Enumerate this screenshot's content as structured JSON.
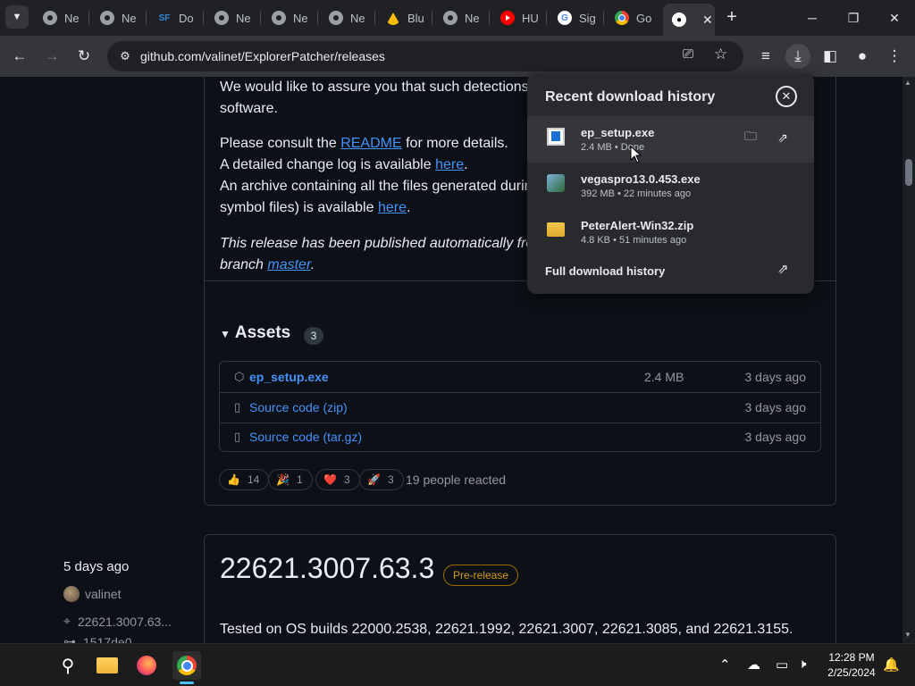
{
  "tabs": [
    {
      "label": "Ne",
      "icon": "chrome-icon"
    },
    {
      "label": "Ne",
      "icon": "chrome-icon"
    },
    {
      "label": "Do",
      "icon": "sf-icon",
      "icon_text": "SF"
    },
    {
      "label": "Ne",
      "icon": "chrome-icon"
    },
    {
      "label": "Ne",
      "icon": "chrome-icon"
    },
    {
      "label": "Ne",
      "icon": "chrome-icon"
    },
    {
      "label": "Blu",
      "icon": "drive-icon"
    },
    {
      "label": "Ne",
      "icon": "chrome-icon"
    },
    {
      "label": "HU",
      "icon": "youtube-icon"
    },
    {
      "label": "Sig",
      "icon": "google-icon",
      "icon_text": "G"
    },
    {
      "label": "Go",
      "icon": "chrome-icon"
    },
    {
      "label": "",
      "icon": "github-icon",
      "active": true
    }
  ],
  "toolbar": {
    "url": "github.com/valinet/ExplorerPatcher/releases"
  },
  "page": {
    "para1_line1": "We would like to assure you that such detections",
    "para1_line2": "software.",
    "consult_prefix": "Please consult the ",
    "readme_link": "README",
    "consult_suffix": " for more details.",
    "changelog_prefix": "A detailed change log is available ",
    "changelog_link": "here",
    "changelog_suffix": ".",
    "archive_line1": "An archive containing all the files generated durin",
    "archive_prefix2": "symbol files) is available ",
    "archive_link": "here",
    "archive_suffix": ".",
    "published_line1": "This release has been published automatically fron",
    "published_prefix2": "branch ",
    "published_link": "master",
    "published_suffix": "."
  },
  "assets": {
    "title": "Assets",
    "count": "3",
    "rows": [
      {
        "name": "ep_setup.exe",
        "bold": true,
        "size": "2.4 MB",
        "date": "3 days ago",
        "icon": "package-icon"
      },
      {
        "name": "Source code (zip)",
        "bold": false,
        "size": "",
        "date": "3 days ago",
        "icon": "file-zip-icon"
      },
      {
        "name": "Source code (tar.gz)",
        "bold": false,
        "size": "",
        "date": "3 days ago",
        "icon": "file-zip-icon"
      }
    ]
  },
  "reactions": [
    {
      "emoji": "👍",
      "count": "14"
    },
    {
      "emoji": "🎉",
      "count": "1"
    },
    {
      "emoji": "❤️",
      "count": "3"
    },
    {
      "emoji": "🚀",
      "count": "3"
    }
  ],
  "reacted_text": "19 people reacted",
  "next_release": {
    "side_date": "5 days ago",
    "author": "valinet",
    "tag": "22621.3007.63...",
    "commit": "1517de0",
    "title": "22621.3007.63.3",
    "badge": "Pre-release",
    "tested": "Tested on OS builds 22000.2538, 22621.1992, 22621.3007, 22621.3085, and 22621.3155."
  },
  "downloads": {
    "title": "Recent download history",
    "items": [
      {
        "name": "ep_setup.exe",
        "meta": "2.4 MB • Done",
        "icon": "exe-icon"
      },
      {
        "name": "vegaspro13.0.453.exe",
        "meta": "392 MB • 22 minutes ago",
        "icon": "vegas-icon"
      },
      {
        "name": "PeterAlert-Win32.zip",
        "meta": "4.8 KB • 51 minutes ago",
        "icon": "zip-icon"
      }
    ],
    "full_history": "Full download history"
  },
  "clock": {
    "time": "12:28 PM",
    "date": "2/25/2024"
  },
  "colors": {
    "page_bg": "#0d1117",
    "link": "#4493f8",
    "prerelease": "#d29922",
    "chrome_toolbar": "#35363a"
  }
}
